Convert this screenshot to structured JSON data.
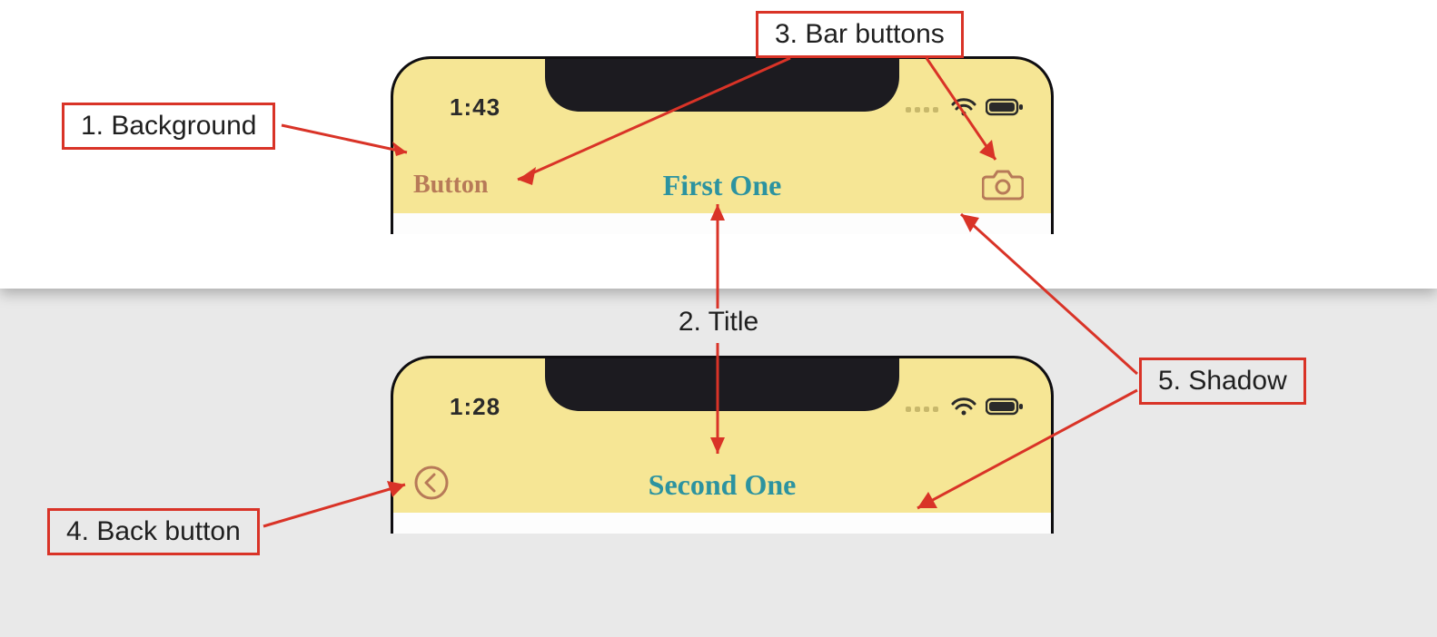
{
  "callouts": {
    "c1": "1. Background",
    "c2": "2. Title",
    "c3": "3. Bar buttons",
    "c4": "4. Back button",
    "c5": "5. Shadow"
  },
  "phone1": {
    "time": "1:43",
    "nav": {
      "left_button_label": "Button",
      "title": "First One",
      "right_icon": "camera-icon"
    }
  },
  "phone2": {
    "time": "1:28",
    "nav": {
      "left_icon": "back-chevron-icon",
      "title": "Second One"
    }
  },
  "colors": {
    "nav_background": "#f6e695",
    "title_text": "#2c93a0",
    "button_tint": "#b77a58",
    "callout_border": "#d93327"
  }
}
